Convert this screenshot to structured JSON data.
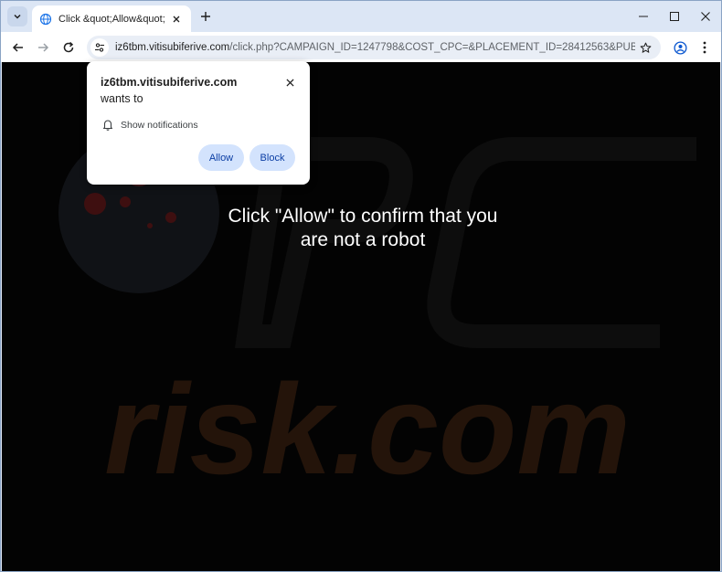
{
  "browser": {
    "tab_title": "Click &quot;Allow&quot;",
    "url_host": "iz6tbm.vitisubiferive.com",
    "url_path": "/click.php?CAMPAIGN_ID=1247798&COST_CPC=&PLACEMENT_ID=28412563&PUBLISHER_ID..."
  },
  "permission_popup": {
    "site": "iz6tbm.vitisubiferive.com",
    "wants_to": " wants to",
    "permission_label": "Show notifications",
    "allow_label": "Allow",
    "block_label": "Block"
  },
  "page": {
    "message": "Click \"Allow\" to confirm that you are not a robot"
  },
  "watermark": {
    "text": "risk.com"
  },
  "colors": {
    "accent": "#0b57d0",
    "button_bg": "#d3e3fd",
    "page_bg": "#030303",
    "watermark": "#2a1609"
  }
}
